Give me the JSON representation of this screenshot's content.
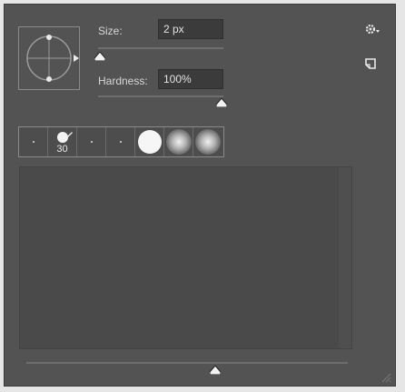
{
  "brush": {
    "size_label": "Size:",
    "size_value": "2 px",
    "hardness_label": "Hardness:",
    "hardness_value": "100%"
  },
  "presets": [
    {
      "kind": "dot"
    },
    {
      "kind": "hard-round-badge",
      "size": "30"
    },
    {
      "kind": "dot"
    },
    {
      "kind": "dot"
    },
    {
      "kind": "hard-round-large"
    },
    {
      "kind": "soft-round"
    },
    {
      "kind": "soft-round"
    }
  ],
  "icons": {
    "settings": "gear-icon",
    "new_preset": "new-preset-icon",
    "resize": "resize-grip-icon"
  },
  "colors": {
    "panel_bg": "#535353",
    "field_bg": "#3b3b3b",
    "text": "#d6d6d6"
  }
}
